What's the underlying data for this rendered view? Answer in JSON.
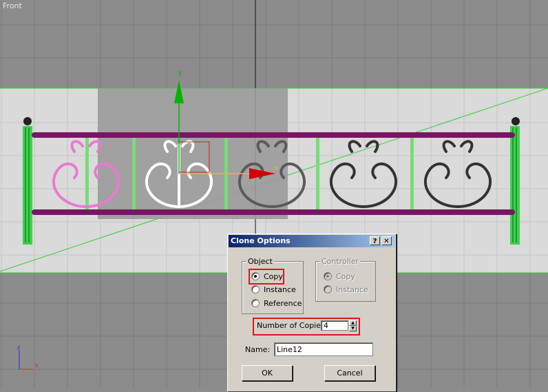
{
  "viewport": {
    "label": "Front"
  },
  "axes": {
    "y": "y",
    "x": "x",
    "gizmo_y": "z",
    "gizmo_x": "x"
  },
  "dialog": {
    "title": "Clone Options",
    "help_button": "?",
    "close_button": "✕",
    "object_group": {
      "label": "Object",
      "options": [
        "Copy",
        "Instance",
        "Reference"
      ],
      "selected": "Copy"
    },
    "controller_group": {
      "label": "Controller",
      "options": [
        "Copy",
        "Instance"
      ],
      "selected": "Copy",
      "disabled": true
    },
    "copies": {
      "label": "Number of Copies:",
      "value": "4"
    },
    "name": {
      "label": "Name:",
      "value": "Line12"
    },
    "ok_label": "OK",
    "cancel_label": "Cancel"
  },
  "colors": {
    "rail": "#7a1564",
    "post": "#3cd24a",
    "selected_ornament": "#ffffff",
    "pink_ornament": "#e87ad2",
    "dark_ornament": "#3a3a3a",
    "highlight": "#e0141e"
  }
}
